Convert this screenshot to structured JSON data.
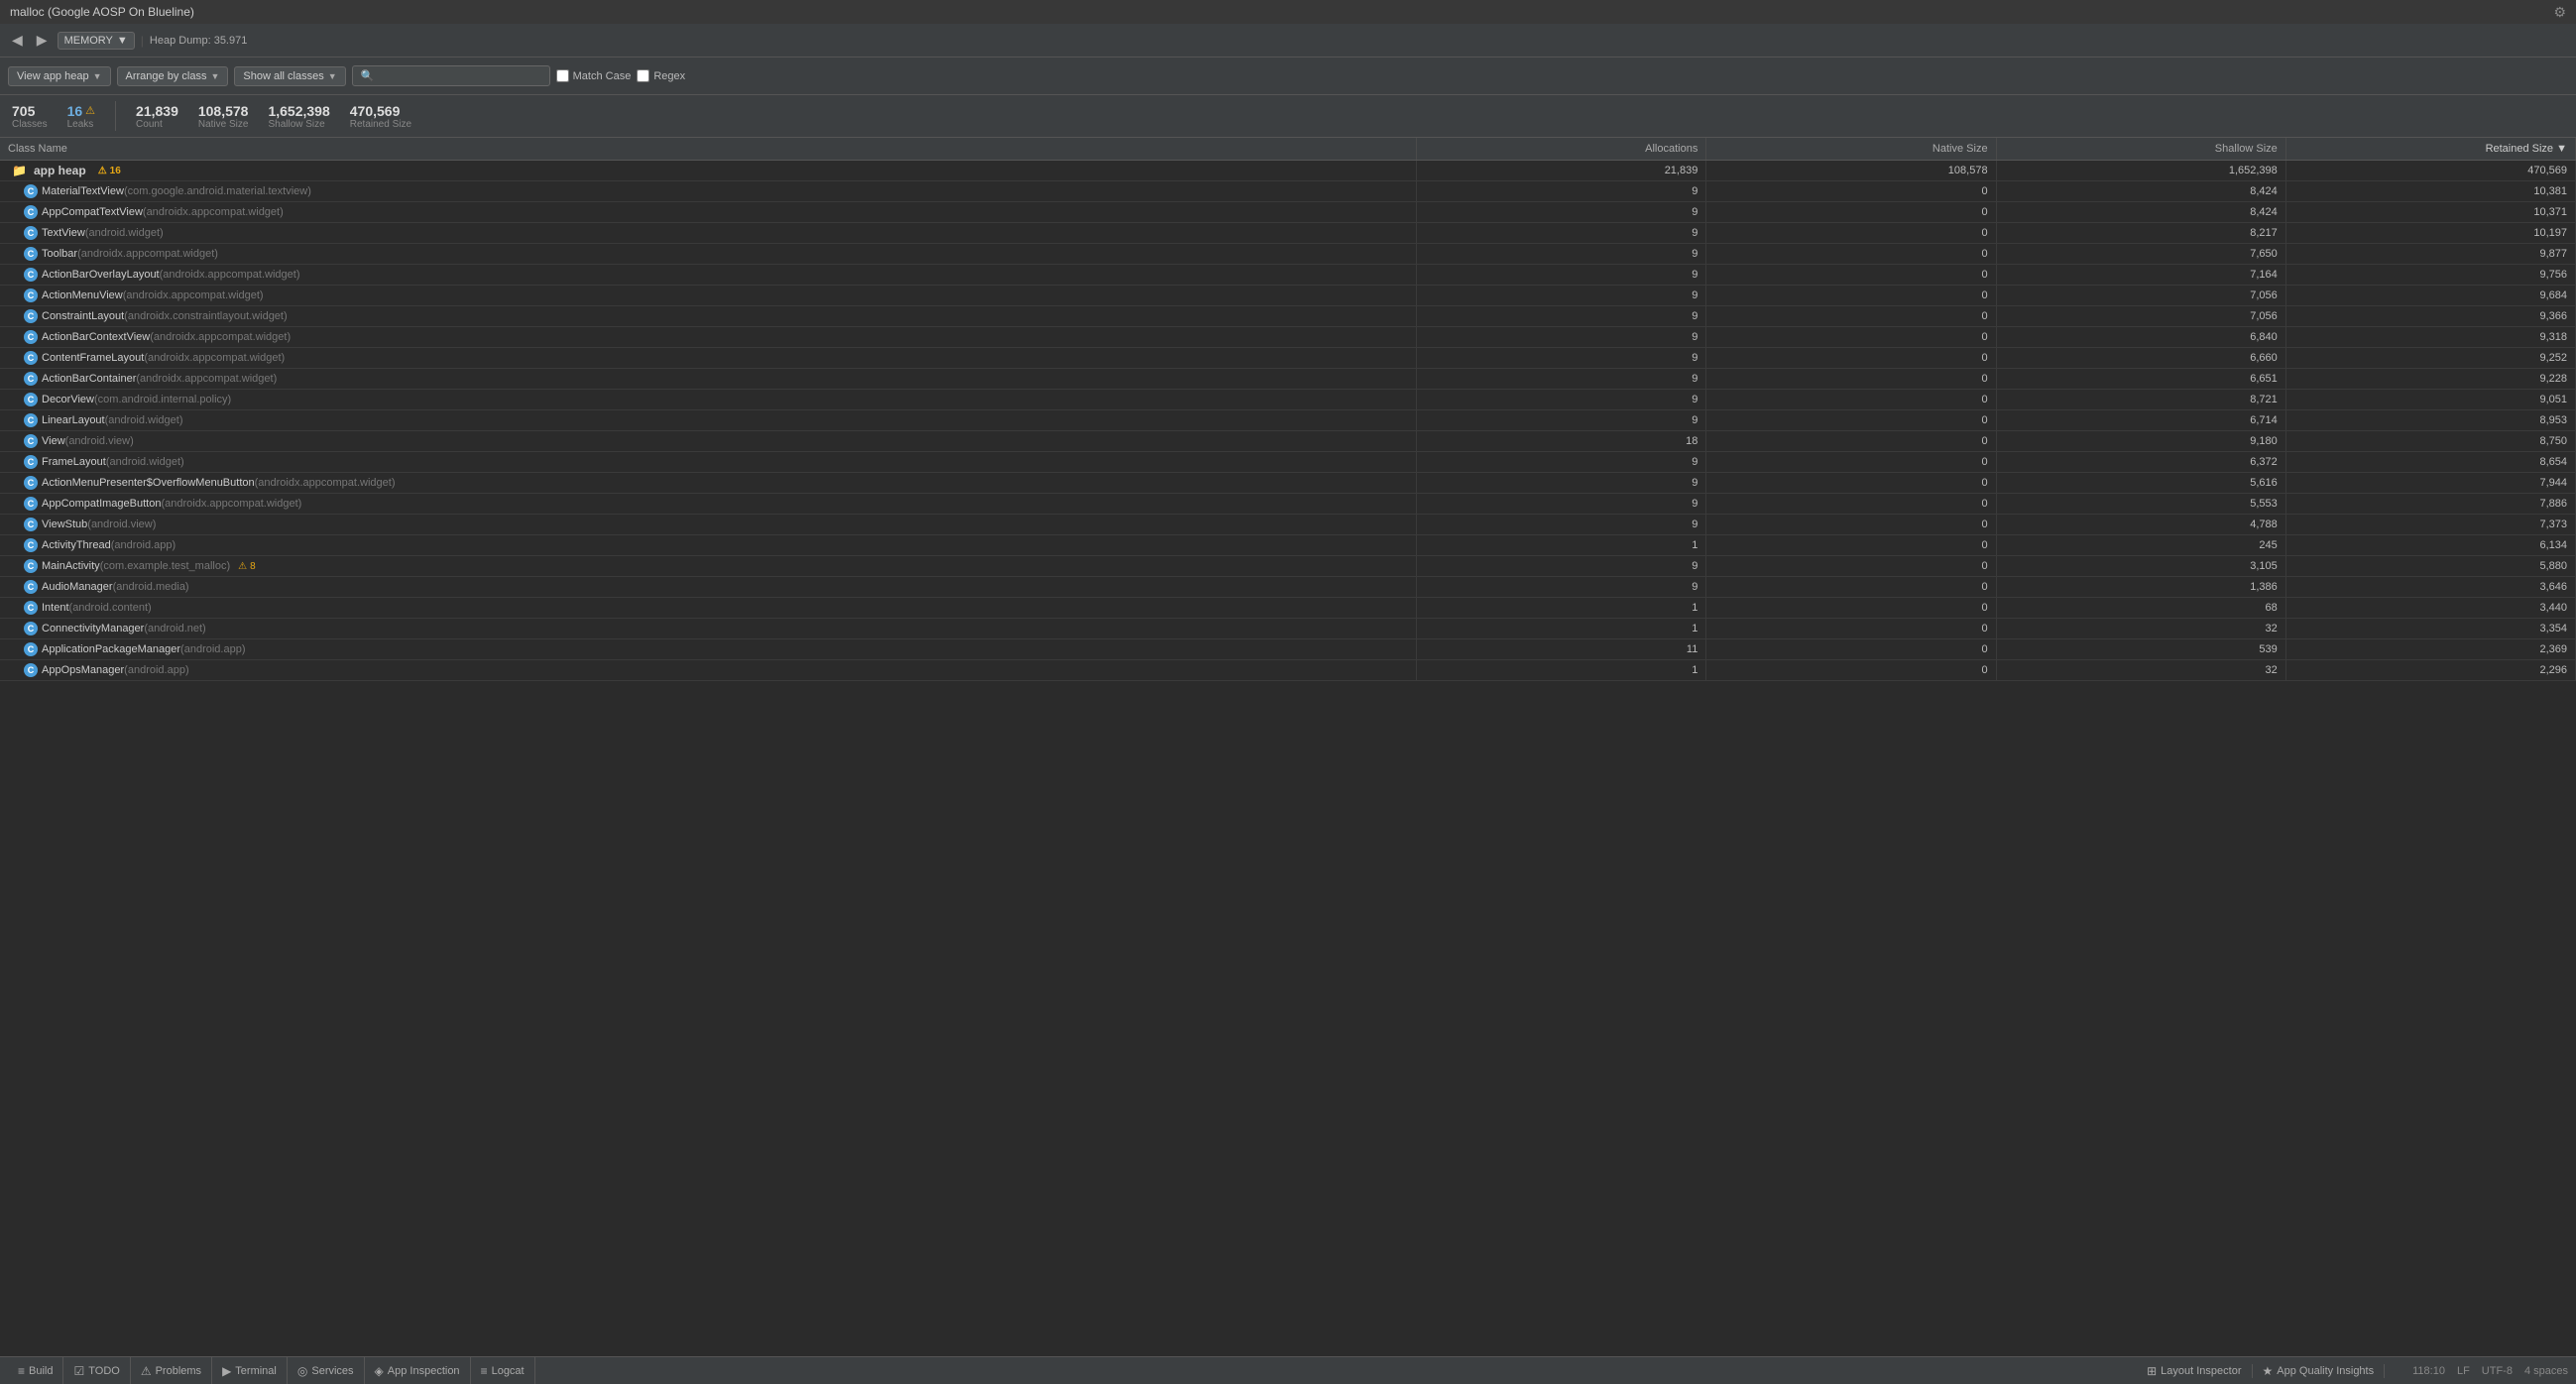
{
  "window": {
    "title": "malloc (Google AOSP On Blueline)",
    "gear_label": "⚙"
  },
  "navbar": {
    "back_label": "◀",
    "forward_label": "▶",
    "memory_label": "MEMORY",
    "heap_dump_label": "Heap Dump: 35.971"
  },
  "toolbar": {
    "view_app_heap_label": "View app heap",
    "arrange_by_class_label": "Arrange by class",
    "show_all_classes_label": "Show all classes",
    "search_placeholder": "🔍",
    "match_case_label": "Match Case",
    "regex_label": "Regex"
  },
  "stats": {
    "classes_value": "705",
    "classes_label": "Classes",
    "leaks_value": "16",
    "leaks_label": "Leaks",
    "count_value": "21,839",
    "count_label": "Count",
    "native_size_value": "108,578",
    "native_size_label": "Native Size",
    "shallow_size_value": "1,652,398",
    "shallow_size_label": "Shallow Size",
    "retained_size_value": "470,569",
    "retained_size_label": "Retained Size"
  },
  "table": {
    "columns": [
      "Class Name",
      "Allocations",
      "Native Size",
      "Shallow Size",
      "Retained Size ▼"
    ],
    "heap_row": {
      "name": "app heap",
      "warnings": "16",
      "allocations": "21,839",
      "native_size": "108,578",
      "shallow_size": "1,652,398",
      "retained_size": "470,569"
    },
    "rows": [
      {
        "name": "MaterialTextView",
        "pkg": "(com.google.android.material.textview)",
        "alloc": "9",
        "native": "0",
        "shallow": "8,424",
        "retained": "10,381"
      },
      {
        "name": "AppCompatTextView",
        "pkg": "(androidx.appcompat.widget)",
        "alloc": "9",
        "native": "0",
        "shallow": "8,424",
        "retained": "10,371"
      },
      {
        "name": "TextView",
        "pkg": "(android.widget)",
        "alloc": "9",
        "native": "0",
        "shallow": "8,217",
        "retained": "10,197"
      },
      {
        "name": "Toolbar",
        "pkg": "(androidx.appcompat.widget)",
        "alloc": "9",
        "native": "0",
        "shallow": "7,650",
        "retained": "9,877"
      },
      {
        "name": "ActionBarOverlayLayout",
        "pkg": "(androidx.appcompat.widget)",
        "alloc": "9",
        "native": "0",
        "shallow": "7,164",
        "retained": "9,756"
      },
      {
        "name": "ActionMenuView",
        "pkg": "(androidx.appcompat.widget)",
        "alloc": "9",
        "native": "0",
        "shallow": "7,056",
        "retained": "9,684"
      },
      {
        "name": "ConstraintLayout",
        "pkg": "(androidx.constraintlayout.widget)",
        "alloc": "9",
        "native": "0",
        "shallow": "7,056",
        "retained": "9,366"
      },
      {
        "name": "ActionBarContextView",
        "pkg": "(androidx.appcompat.widget)",
        "alloc": "9",
        "native": "0",
        "shallow": "6,840",
        "retained": "9,318"
      },
      {
        "name": "ContentFrameLayout",
        "pkg": "(androidx.appcompat.widget)",
        "alloc": "9",
        "native": "0",
        "shallow": "6,660",
        "retained": "9,252"
      },
      {
        "name": "ActionBarContainer",
        "pkg": "(androidx.appcompat.widget)",
        "alloc": "9",
        "native": "0",
        "shallow": "6,651",
        "retained": "9,228"
      },
      {
        "name": "DecorView",
        "pkg": "(com.android.internal.policy)",
        "alloc": "9",
        "native": "0",
        "shallow": "8,721",
        "retained": "9,051"
      },
      {
        "name": "LinearLayout",
        "pkg": "(android.widget)",
        "alloc": "9",
        "native": "0",
        "shallow": "6,714",
        "retained": "8,953"
      },
      {
        "name": "View",
        "pkg": "(android.view)",
        "alloc": "18",
        "native": "0",
        "shallow": "9,180",
        "retained": "8,750"
      },
      {
        "name": "FrameLayout",
        "pkg": "(android.widget)",
        "alloc": "9",
        "native": "0",
        "shallow": "6,372",
        "retained": "8,654"
      },
      {
        "name": "ActionMenuPresenter$OverflowMenuButton",
        "pkg": "(androidx.appcompat.widget)",
        "alloc": "9",
        "native": "0",
        "shallow": "5,616",
        "retained": "7,944"
      },
      {
        "name": "AppCompatImageButton",
        "pkg": "(androidx.appcompat.widget)",
        "alloc": "9",
        "native": "0",
        "shallow": "5,553",
        "retained": "7,886"
      },
      {
        "name": "ViewStub",
        "pkg": "(android.view)",
        "alloc": "9",
        "native": "0",
        "shallow": "4,788",
        "retained": "7,373"
      },
      {
        "name": "ActivityThread",
        "pkg": "(android.app)",
        "alloc": "1",
        "native": "0",
        "shallow": "245",
        "retained": "6,134"
      },
      {
        "name": "MainActivity",
        "pkg": "(com.example.test_malloc)",
        "alloc": "9",
        "native": "0",
        "shallow": "3,105",
        "retained": "5,880",
        "warnings": "8"
      },
      {
        "name": "AudioManager",
        "pkg": "(android.media)",
        "alloc": "9",
        "native": "0",
        "shallow": "1,386",
        "retained": "3,646"
      },
      {
        "name": "Intent",
        "pkg": "(android.content)",
        "alloc": "1",
        "native": "0",
        "shallow": "68",
        "retained": "3,440"
      },
      {
        "name": "ConnectivityManager",
        "pkg": "(android.net)",
        "alloc": "1",
        "native": "0",
        "shallow": "32",
        "retained": "3,354"
      },
      {
        "name": "ApplicationPackageManager",
        "pkg": "(android.app)",
        "alloc": "11",
        "native": "0",
        "shallow": "539",
        "retained": "2,369"
      },
      {
        "name": "AppOpsManager",
        "pkg": "(android.app)",
        "alloc": "1",
        "native": "0",
        "shallow": "32",
        "retained": "2,296"
      }
    ]
  },
  "bottom_tabs": [
    {
      "icon": "≡",
      "label": "Build"
    },
    {
      "icon": "☑",
      "label": "TODO"
    },
    {
      "icon": "⚠",
      "label": "Problems"
    },
    {
      "icon": "▶",
      "label": "Terminal"
    },
    {
      "icon": "◎",
      "label": "Services"
    },
    {
      "icon": "◈",
      "label": "App Inspection"
    },
    {
      "icon": "≡",
      "label": "Logcat"
    }
  ],
  "bottom_tabs_right": [
    {
      "icon": "⊞",
      "label": "Layout Inspector"
    },
    {
      "icon": "★",
      "label": "App Quality Insights"
    }
  ],
  "status_right": {
    "position": "118:10",
    "encoding": "LF",
    "charset": "UTF-8",
    "indent": "4 spaces"
  }
}
